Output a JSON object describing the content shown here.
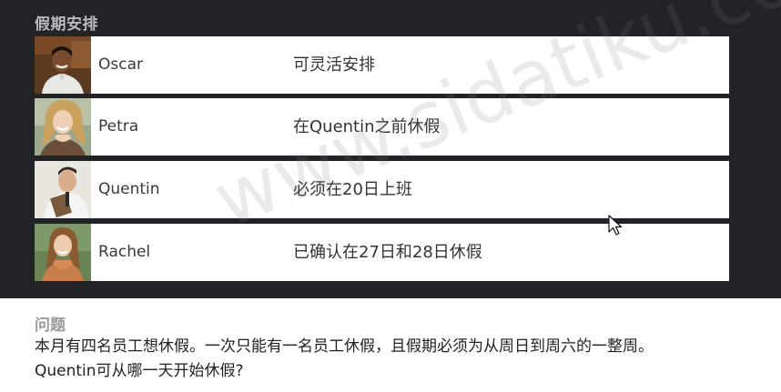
{
  "section_title": "假期安排",
  "rows": [
    {
      "name": "Oscar",
      "note": "可灵活安排"
    },
    {
      "name": "Petra",
      "note": "在Quentin之前休假"
    },
    {
      "name": "Quentin",
      "note": "必须在20日上班"
    },
    {
      "name": "Rachel",
      "note": "已确认在27日和28日休假"
    }
  ],
  "question": {
    "title": "问题",
    "line1": "本月有四名员工想休假。一次只能有一名员工休假，且假期必须为从周日到周六的一整周。",
    "line2": "Quentin可从哪一天开始休假?"
  },
  "watermark": "www.sidatiku.com",
  "colors": {
    "panel_bg": "#222326",
    "row_bg": "#ffffff",
    "title_text": "#b9babd"
  }
}
